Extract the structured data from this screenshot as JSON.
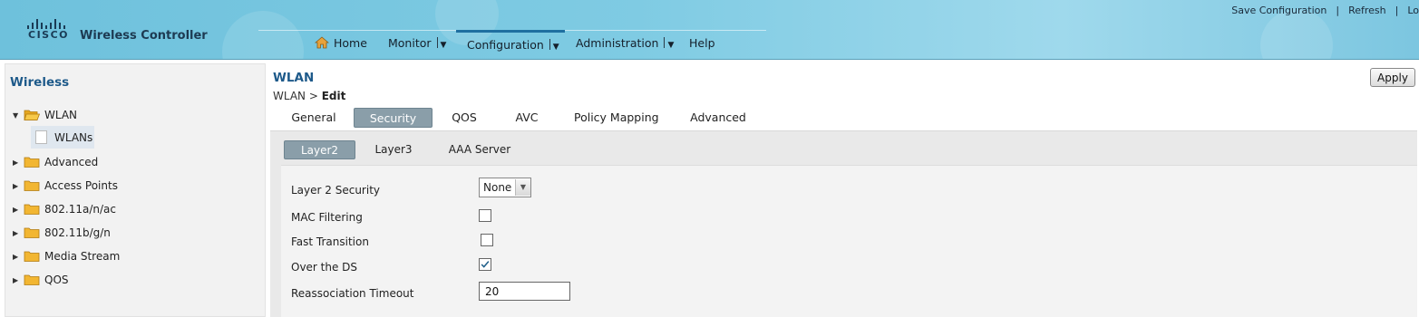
{
  "header": {
    "brand": "CISCO",
    "product_name": "Wireless Controller",
    "top_links": [
      "Save Configuration",
      "Refresh",
      "Lo"
    ],
    "nav": [
      {
        "label": "Home",
        "icon": "home-icon"
      },
      {
        "label": "Monitor",
        "dropdown": true
      },
      {
        "label": "Configuration",
        "dropdown": true,
        "active": true
      },
      {
        "label": "Administration",
        "dropdown": true
      },
      {
        "label": "Help"
      }
    ]
  },
  "sidebar": {
    "title": "Wireless",
    "items": [
      {
        "label": "WLAN",
        "expanded": true,
        "icon": "folder-open-icon"
      },
      {
        "label": "WLANs",
        "selected": true,
        "icon": "page-icon"
      },
      {
        "label": "Advanced",
        "icon": "folder-icon"
      },
      {
        "label": "Access Points",
        "icon": "folder-icon"
      },
      {
        "label": "802.11a/n/ac",
        "icon": "folder-icon"
      },
      {
        "label": "802.11b/g/n",
        "icon": "folder-icon"
      },
      {
        "label": "Media Stream",
        "icon": "folder-icon"
      },
      {
        "label": "QOS",
        "icon": "folder-icon"
      }
    ]
  },
  "main": {
    "title": "WLAN",
    "breadcrumb_prefix": "WLAN > ",
    "breadcrumb_current": "Edit",
    "apply_label": "Apply",
    "tabs": [
      "General",
      "Security",
      "QOS",
      "AVC",
      "Policy Mapping",
      "Advanced"
    ],
    "active_tab": "Security",
    "subtabs": [
      "Layer2",
      "Layer3",
      "AAA Server"
    ],
    "active_subtab": "Layer2",
    "form": {
      "layer2_security_label": "Layer 2 Security",
      "layer2_security_value": "None",
      "mac_filtering_label": "MAC Filtering",
      "mac_filtering_checked": false,
      "fast_transition_label": "Fast Transition",
      "fast_transition_checked": false,
      "over_the_ds_label": "Over the DS",
      "over_the_ds_checked": true,
      "reassociation_timeout_label": "Reassociation Timeout",
      "reassociation_timeout_value": "20"
    }
  },
  "colors": {
    "header_bg": "#7fcbe3",
    "title_blue": "#1e5a8a",
    "active_tab_bg": "#8a9ea9",
    "folder_yellow": "#f2b632"
  }
}
